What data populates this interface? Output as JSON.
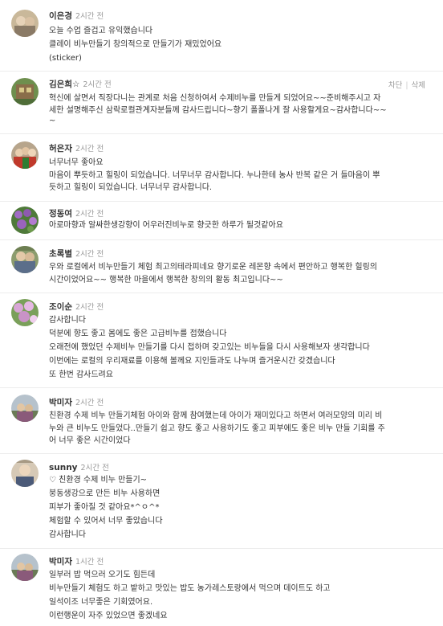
{
  "actions": {
    "block": "차단",
    "sep": "|",
    "delete": "삭제"
  },
  "comments": [
    {
      "name": "이은경",
      "time": "2시간 전",
      "lines": [
        "오늘 수업 즐겁고 유익했습니다",
        "클레이 비누만들기 창의적으로 만들기가 재밌었어요",
        "(sticker)"
      ]
    },
    {
      "name": "김은희☆",
      "time": "2시간 전",
      "lines": [
        "혁신에 살면서 직장다니는 관계로 처음 신청하여서 수제비누를 만들게 되었어요~~준비해주시고 자",
        "세한 설명해주신 삼락로컬관계자분들께 감사드립니다~향기 폴폴나게 잘 사용할게요~감사합니다~~",
        "~"
      ]
    },
    {
      "name": "허은자",
      "time": "2시간 전",
      "lines": [
        "너무너무 좋아요",
        "마음이 뿌듯하고 힐링이 되었습니다. 너무너무 감사합니다. 누나한테 농사 반복 같은 거 들마음이 뿌",
        "듯하고 힐링이 되었습니다. 너무너무 감사합니다."
      ]
    },
    {
      "name": "정동여",
      "time": "2시간 전",
      "lines": [
        "아로마향과 알싸한생강향이 어우러진비누로 향긋한 하루가 될것같아요"
      ]
    },
    {
      "name": "초록별",
      "time": "2시간 전",
      "lines": [
        "우와 로컬에서 비누만들기 체험 최고의테라피네요 향기로운 레몬향 속에서 편안하고 행복한 힐링의",
        "시간이었어요~~ 행복한 마을에서 행복한 창의의 활동 최고입니다~~"
      ]
    },
    {
      "name": "조이순",
      "time": "2시간 전",
      "lines": [
        "감사합니다",
        "덕분에 향도 좋고 몸에도 좋은 고급비누를 접했습니다",
        "오래전에 했었던 수제비누 만들기를 다시 접하며 갖고있는 비누들을 다시 사용해보자 생각합니다",
        "이번에는 로컬의 우리재료를 이용해 볼께요 지인들과도 나누며 즐거운시간 갖겠습니다",
        "또 한번 감사드려요"
      ]
    },
    {
      "name": "박미자",
      "time": "2시간 전",
      "lines": [
        "친환경 수제 비누 만들기체험 아이와 함께 참여했는데 아이가 재미있다고 하면서 여러모양의 미리 비",
        "누와 큰 비누도 만들었다..만들기 쉽고 향도 좋고 사용하기도 좋고 피부에도 좋은 비누 만들 기회를 주",
        "어 너무 좋은 시간이었다"
      ]
    },
    {
      "name": "sunny",
      "time": "2시간 전",
      "lines": [
        "♡ 친환경 수제 비누 만들기~",
        "붕동생강으로 만든 비누 사용하면",
        "피부가 좋아질 것 같아요*^ㅇ^*",
        "체험할 수 있어서 너무 좋았습니다",
        "감사합니다"
      ]
    },
    {
      "name": "박미자",
      "time": "1시간 전",
      "lines": [
        "일부러 밥 먹으러 오기도 힘든데",
        "비누만들기 체험도 하고 밭하고 맛있는 밥도 농가레스토랑에서 먹으며 데이트도 하고",
        "일석이조 너무좋은 기회였어요.",
        "이런행운이 자주 있었으면 좋겠네요"
      ]
    }
  ]
}
